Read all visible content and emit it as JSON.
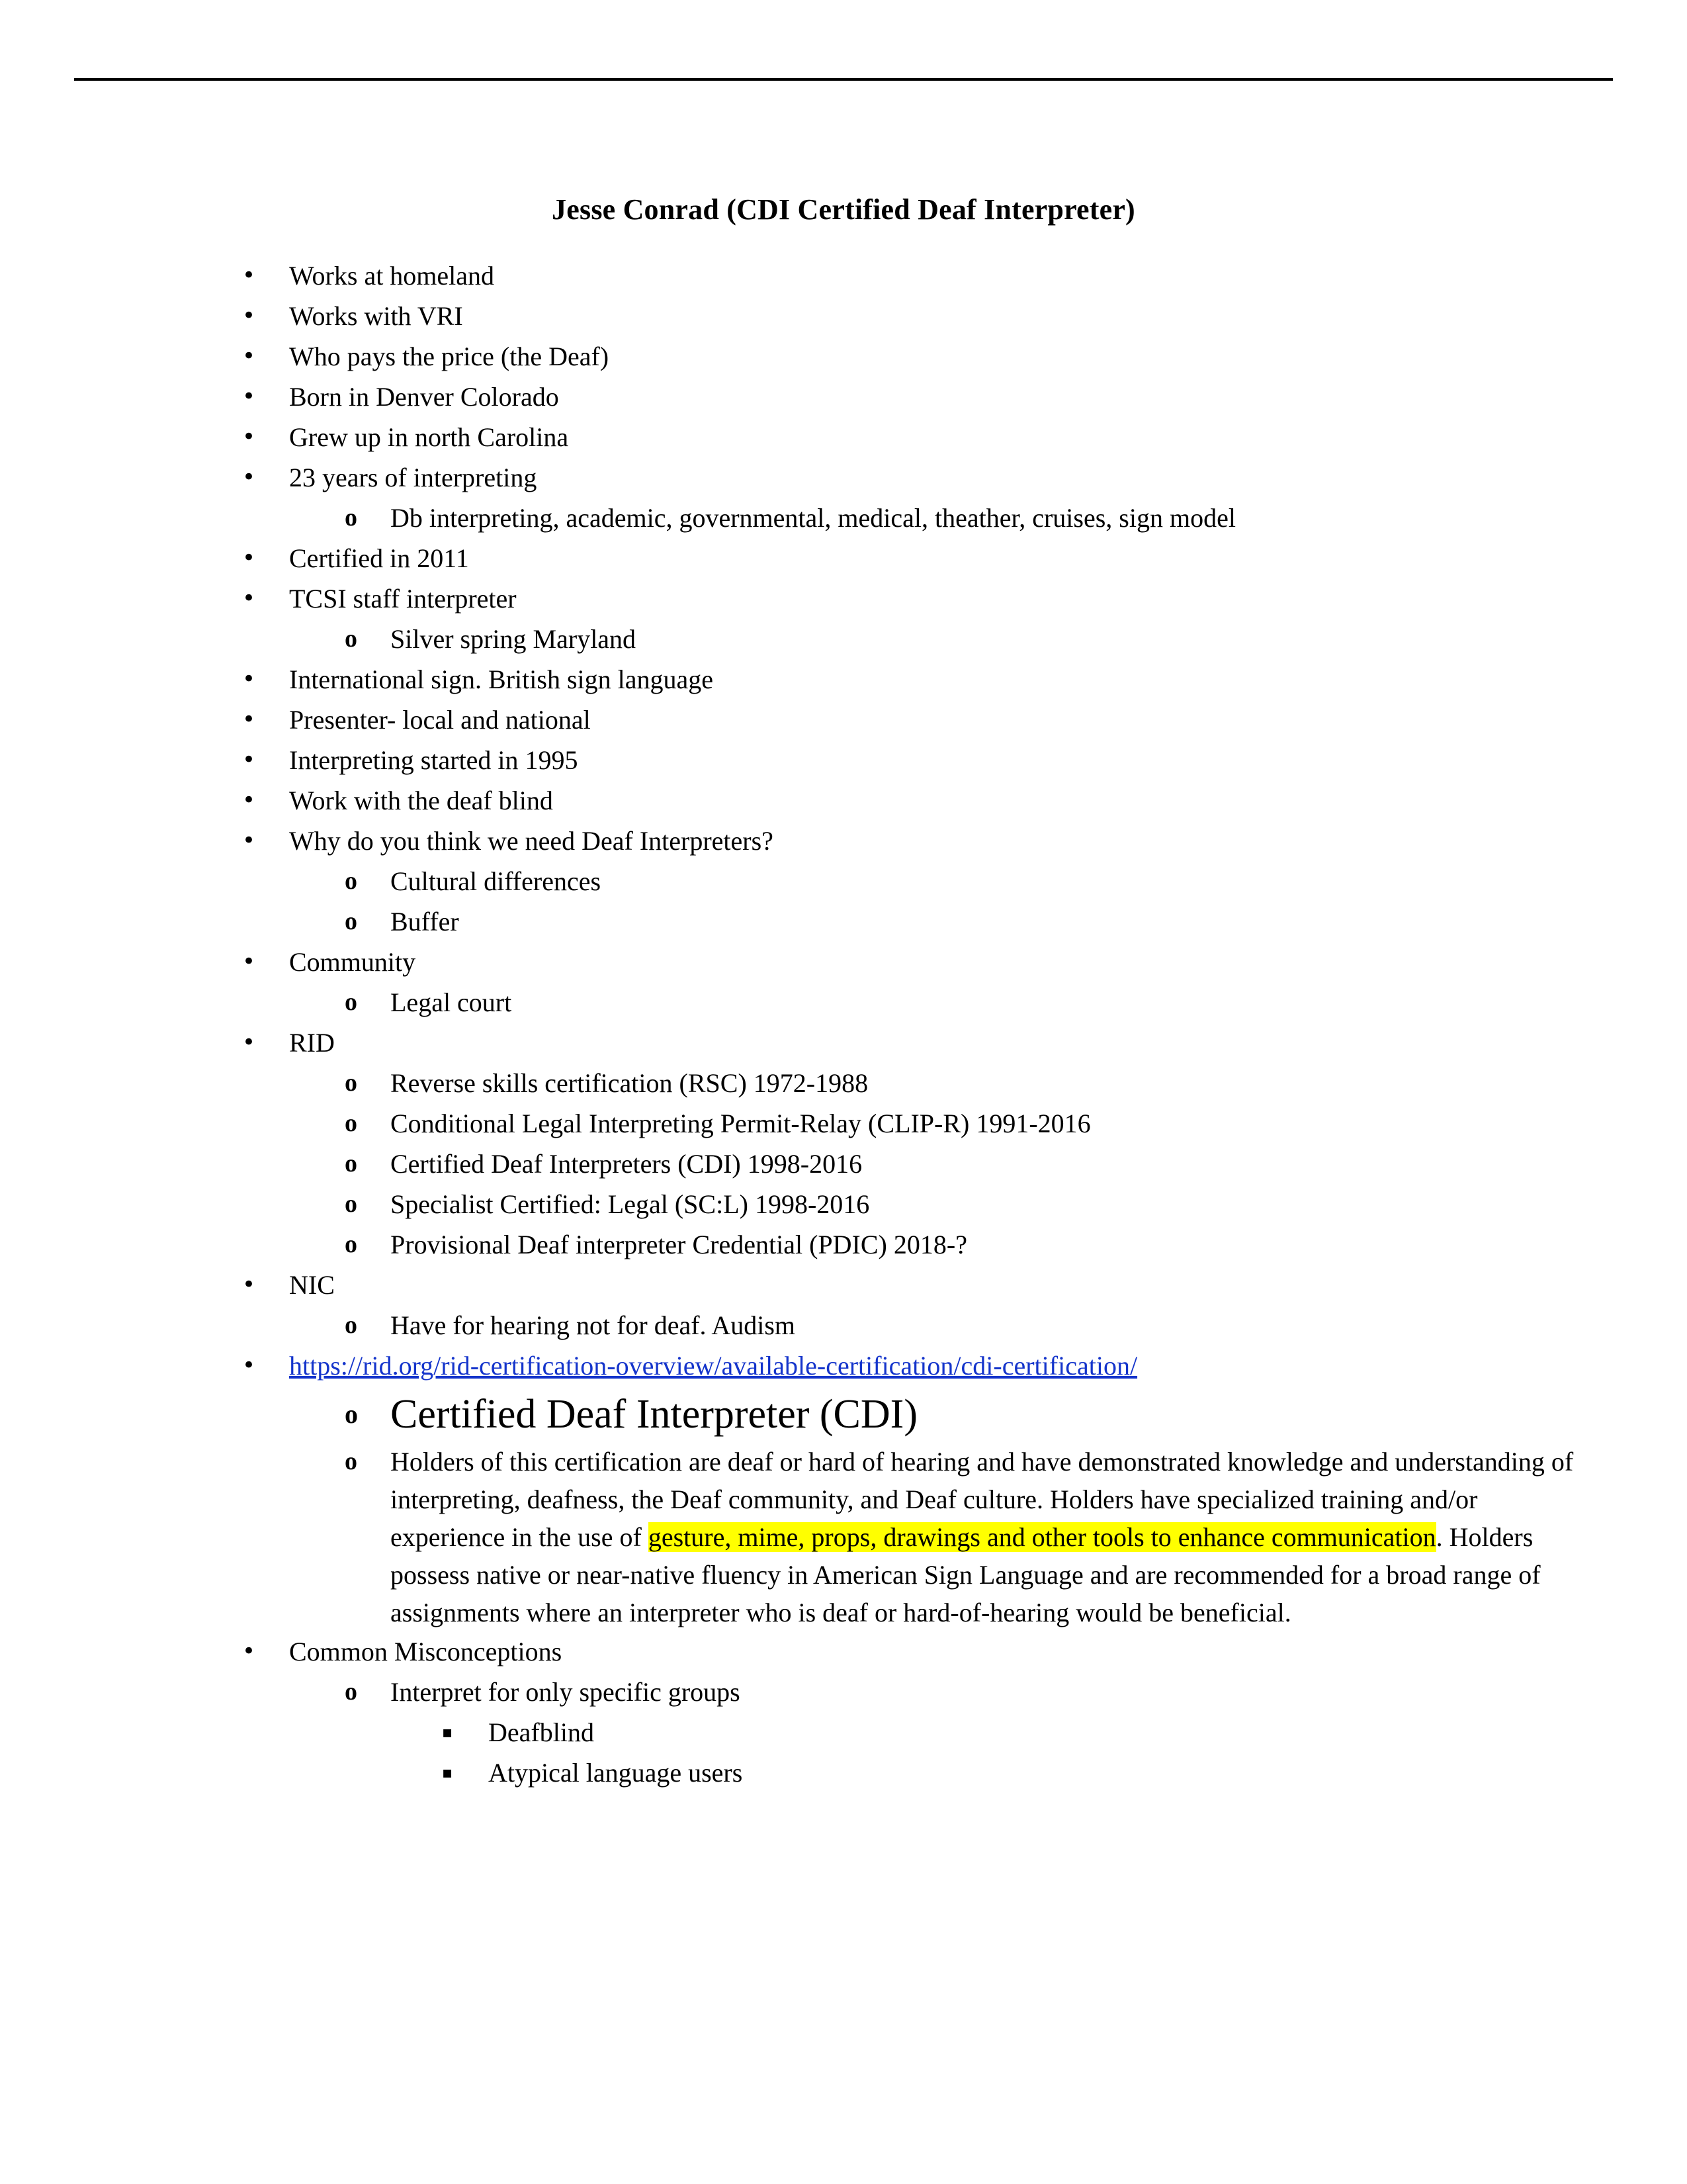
{
  "document": {
    "title": "Jesse Conrad (CDI Certified Deaf Interpreter)",
    "header_rule": true,
    "link_color": "#1434CB",
    "highlight_color": "#FFFF00",
    "markers": {
      "level1": "•",
      "level2": "o",
      "level3": "▪"
    }
  },
  "outline": [
    {
      "level": 1,
      "text": "Works at homeland"
    },
    {
      "level": 1,
      "text": "Works with VRI"
    },
    {
      "level": 1,
      "text": "Who pays the price (the Deaf)"
    },
    {
      "level": 1,
      "text": "Born in Denver Colorado"
    },
    {
      "level": 1,
      "text": "Grew up in north Carolina"
    },
    {
      "level": 1,
      "text": "23 years of interpreting"
    },
    {
      "level": 2,
      "text": "Db interpreting, academic, governmental, medical, theather, cruises, sign model"
    },
    {
      "level": 1,
      "text": "Certified in 2011"
    },
    {
      "level": 1,
      "text": "TCSI staff interpreter"
    },
    {
      "level": 2,
      "text": "Silver spring Maryland"
    },
    {
      "level": 1,
      "text": "International sign. British sign language"
    },
    {
      "level": 1,
      "text": "Presenter- local and national"
    },
    {
      "level": 1,
      "text": "Interpreting started in 1995"
    },
    {
      "level": 1,
      "text": "Work with the deaf blind"
    },
    {
      "level": 1,
      "text": "Why do you think we need Deaf Interpreters?"
    },
    {
      "level": 2,
      "text": "Cultural differences"
    },
    {
      "level": 2,
      "text": "Buffer"
    },
    {
      "level": 1,
      "text": "Community"
    },
    {
      "level": 2,
      "text": "Legal court"
    },
    {
      "level": 1,
      "text": "RID"
    },
    {
      "level": 2,
      "text": "Reverse skills certification (RSC) 1972-1988"
    },
    {
      "level": 2,
      "text": "Conditional Legal Interpreting Permit-Relay (CLIP-R) 1991-2016"
    },
    {
      "level": 2,
      "text": "Certified Deaf Interpreters (CDI) 1998-2016"
    },
    {
      "level": 2,
      "text": "Specialist Certified: Legal (SC:L) 1998-2016"
    },
    {
      "level": 2,
      "text": "Provisional Deaf interpreter Credential (PDIC) 2018-?"
    },
    {
      "level": 1,
      "text": "NIC"
    },
    {
      "level": 2,
      "text": "Have for hearing not for deaf. Audism"
    },
    {
      "level": 1,
      "kind": "link",
      "text": "https://rid.org/rid-certification-overview/available-certification/cdi-certification/"
    },
    {
      "level": 2,
      "kind": "heading",
      "text": "Certified Deaf Interpreter (CDI)"
    },
    {
      "level": 2,
      "kind": "paragraph",
      "segments": [
        {
          "text": "Holders of this certification are deaf or hard of hearing and have demonstrated knowledge and understanding of interpreting, deafness, the Deaf community, and Deaf culture. Holders have specialized training and/or experience in the use of "
        },
        {
          "text": "gesture, mime, props, drawings and other tools to enhance communication",
          "highlight": true
        },
        {
          "text": ". Holders possess native or near-native fluency in American Sign Language and are recommended for a broad range of assignments where an interpreter who is deaf or hard-of-hearing would be beneficial."
        }
      ]
    },
    {
      "level": 1,
      "text": "Common Misconceptions"
    },
    {
      "level": 2,
      "text": "Interpret for only specific groups"
    },
    {
      "level": 3,
      "text": "Deafblind"
    },
    {
      "level": 3,
      "text": "Atypical language users"
    }
  ]
}
